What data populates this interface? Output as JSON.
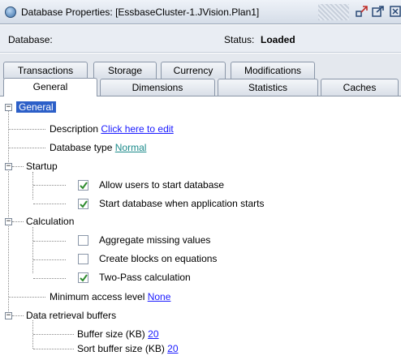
{
  "window": {
    "title": "Database Properties: [EssbaseCluster-1.JVision.Plan1]",
    "icons": [
      "database-icon",
      "undock-icon",
      "maximize-icon",
      "close-icon"
    ]
  },
  "infobar": {
    "database_label": "Database:",
    "status_label": "Status:",
    "status_value": "Loaded"
  },
  "tabs": {
    "row1": [
      "Transactions",
      "Storage",
      "Currency",
      "Modifications"
    ],
    "row2": [
      "General",
      "Dimensions",
      "Statistics",
      "Caches"
    ],
    "active": "General"
  },
  "tree": {
    "root": "General",
    "description": {
      "label": "Description",
      "value": "Click here to edit"
    },
    "database_type": {
      "label": "Database type",
      "value": "Normal"
    },
    "startup": {
      "label": "Startup",
      "items": [
        {
          "label": "Allow users to start database",
          "checked": true
        },
        {
          "label": "Start database when application starts",
          "checked": true
        }
      ]
    },
    "calculation": {
      "label": "Calculation",
      "items": [
        {
          "label": "Aggregate missing values",
          "checked": false
        },
        {
          "label": "Create blocks on equations",
          "checked": false
        },
        {
          "label": "Two-Pass calculation",
          "checked": true
        }
      ]
    },
    "min_access": {
      "label": "Minimum access level",
      "value": "None"
    },
    "data_retrieval": {
      "label": "Data retrieval buffers",
      "buffer_size": {
        "label": "Buffer size (KB)",
        "value": "20"
      },
      "sort_buffer_size": {
        "label": "Sort buffer size (KB)",
        "value": "20"
      }
    }
  },
  "colors": {
    "selection": "#2c5fc8",
    "link": "#1a1aff",
    "link_teal": "#1a8a8a",
    "check": "#2e8b2e"
  }
}
